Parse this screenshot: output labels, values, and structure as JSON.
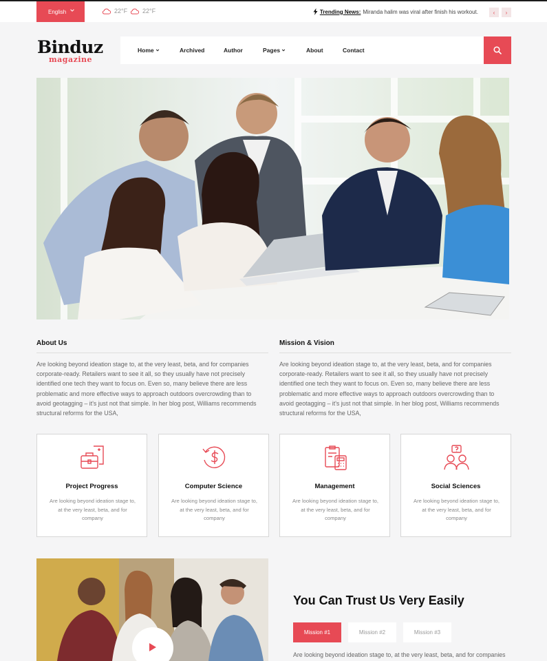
{
  "topbar": {
    "language": "English",
    "weather": [
      {
        "temp": "22°F",
        "icon": "cloud-icon"
      },
      {
        "temp": "22°F",
        "icon": "cloud-icon"
      }
    ],
    "trending_label": "Trending News:",
    "trending_text": "Miranda halim was viral after finish his workout.",
    "prev_label": "‹",
    "next_label": "›"
  },
  "header": {
    "logo_main": "Binduz",
    "logo_sub": "magazine",
    "nav": [
      {
        "label": "Home",
        "has_dropdown": true
      },
      {
        "label": "Archived",
        "has_dropdown": false
      },
      {
        "label": "Author",
        "has_dropdown": false
      },
      {
        "label": "Pages",
        "has_dropdown": true
      },
      {
        "label": "About",
        "has_dropdown": false
      },
      {
        "label": "Contact",
        "has_dropdown": false
      }
    ]
  },
  "about": {
    "title": "About Us",
    "text": "Are looking beyond ideation stage to, at the very least, beta, and for companies corporate-ready. Retailers want to see it all, so they usually have not precisely identified one tech they want to focus on. Even so, many believe there are less problematic and more effective ways to approach outdoors overcrowding than to avoid geotagging – it's just not that simple. In her blog post, Williams recommends structural reforms for the USA,"
  },
  "mission": {
    "title": "Mission & Vision",
    "text": "Are looking beyond ideation stage to, at the very least, beta, and for companies corporate-ready. Retailers want to see it all, so they usually have not precisely identified one tech they want to focus on. Even so, many believe there are less problematic and more effective ways to approach outdoors overcrowding than to avoid geotagging – it's just not that simple. In her blog post, Williams recommends structural reforms for the USA,"
  },
  "cards": [
    {
      "title": "Project Progress",
      "text": "Are looking beyond ideation stage to, at the very least, beta, and for company",
      "icon": "briefcase-icon"
    },
    {
      "title": "Computer Science",
      "text": "Are looking beyond ideation stage to, at the very least, beta, and for company",
      "icon": "dollar-refresh-icon"
    },
    {
      "title": "Management",
      "text": "Are looking beyond ideation stage to, at the very least, beta, and for company",
      "icon": "calculator-clipboard-icon"
    },
    {
      "title": "Social Sciences",
      "text": "Are looking beyond ideation stage to, at the very least, beta, and for company",
      "icon": "people-question-icon"
    }
  ],
  "trust": {
    "title": "You Can Trust Us Very Easily",
    "tabs": [
      "Mission #1",
      "Mission #2",
      "Mission #3"
    ],
    "text": "Are looking beyond ideation stage to, at the very least, beta, and for companies"
  },
  "colors": {
    "accent": "#e74a55",
    "background": "#f5f5f6",
    "dark": "#111111"
  }
}
